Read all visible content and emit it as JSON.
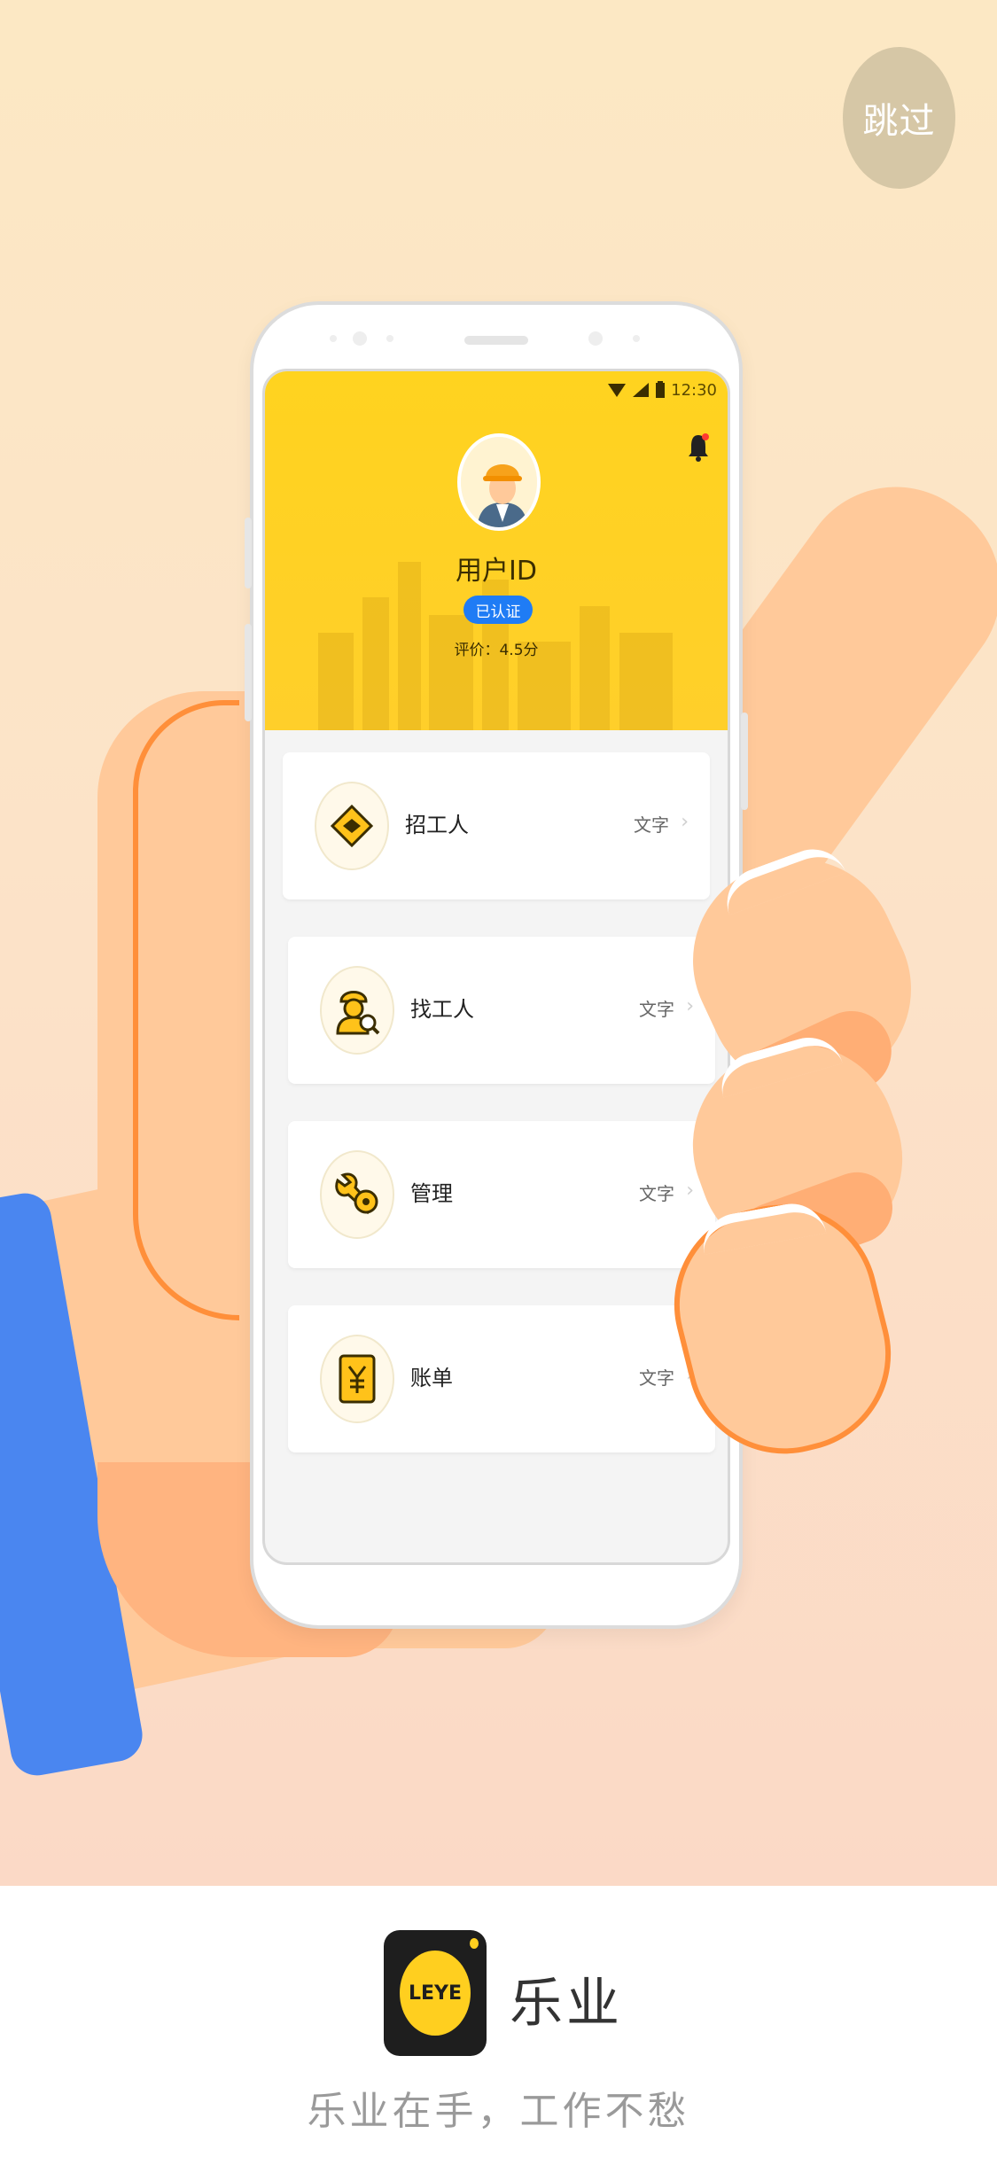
{
  "skip_label": "跳过",
  "phone": {
    "status_time": "12:30",
    "user_id": "用户ID",
    "verified": "已认证",
    "rating": "评价：4.5分",
    "menu": [
      {
        "label": "招工人",
        "value": "文字",
        "icon": "handshake-icon"
      },
      {
        "label": "找工人",
        "value": "文字",
        "icon": "worker-search-icon"
      },
      {
        "label": "管理",
        "value": "文字",
        "icon": "wrench-gear-icon"
      },
      {
        "label": "账单",
        "value": "文字",
        "icon": "yuan-bill-icon"
      }
    ]
  },
  "brand": {
    "logo_text": "LEYE",
    "name": "乐业",
    "slogan": "乐业在手，工作不愁"
  },
  "colors": {
    "header_yellow": "#ffd31f",
    "badge_blue": "#1f7cf5",
    "sleeve_blue": "#4a86f0",
    "skin": "#ffc99a",
    "outline_orange": "#ff8f3a"
  }
}
